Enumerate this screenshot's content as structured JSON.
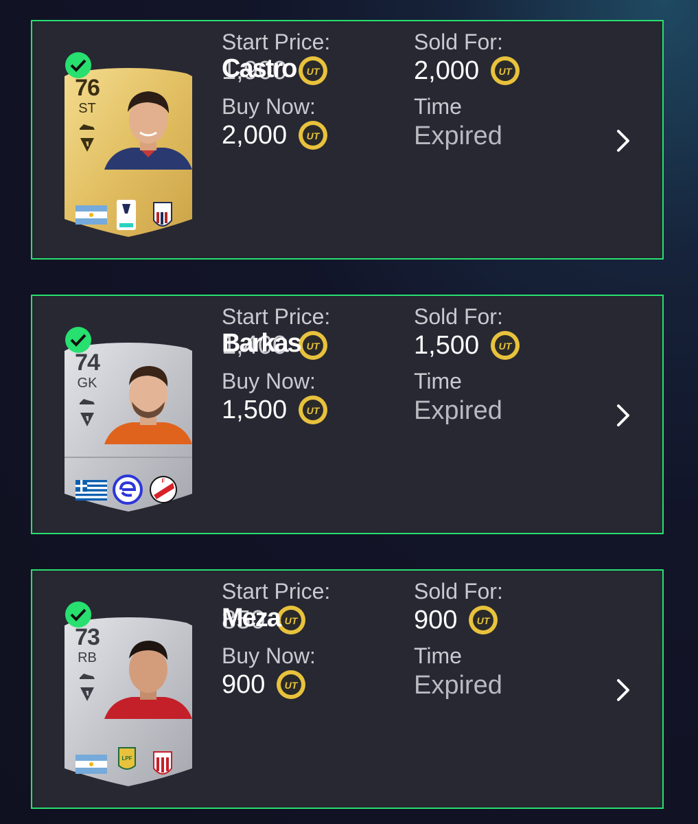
{
  "labels": {
    "start_price": "Start Price:",
    "sold_for": "Sold For:",
    "buy_now": "Buy Now:",
    "time": "Time",
    "expired": "Expired"
  },
  "colors": {
    "success_green": "#27e06f",
    "tile_bg": "#262630",
    "gold_card": "#e7c66f",
    "silver_card": "#c7c9cf",
    "coin_gold": "#e8c23c"
  },
  "icons": {
    "sold_check": "check-circle-icon",
    "coin": "ut-coin-icon",
    "chevron": "chevron-right-icon",
    "boot": "boot-icon",
    "chemistry": "chemistry-style-icon"
  },
  "items": [
    {
      "player_name": "Castro",
      "start_price": "1,900",
      "sold_for": "2,000",
      "buy_now": "2,000",
      "time": "Expired",
      "card": {
        "rating": "76",
        "position": "ST",
        "tier": "gold",
        "nation_flag": "argentina-flag",
        "league": "serie-a-badge",
        "club": "bologna-badge"
      }
    },
    {
      "player_name": "Barkas",
      "start_price": "1,400",
      "sold_for": "1,500",
      "buy_now": "1,500",
      "time": "Expired",
      "card": {
        "rating": "74",
        "position": "GK",
        "tier": "silver",
        "nation_flag": "greece-flag",
        "league": "eredivisie-badge",
        "club": "fc-utrecht-badge"
      }
    },
    {
      "player_name": "Meza",
      "start_price": "850",
      "sold_for": "900",
      "buy_now": "900",
      "time": "Expired",
      "card": {
        "rating": "73",
        "position": "RB",
        "tier": "silver",
        "nation_flag": "argentina-flag",
        "league": "liga-profesional-badge",
        "club": "estudiantes-badge"
      }
    }
  ]
}
